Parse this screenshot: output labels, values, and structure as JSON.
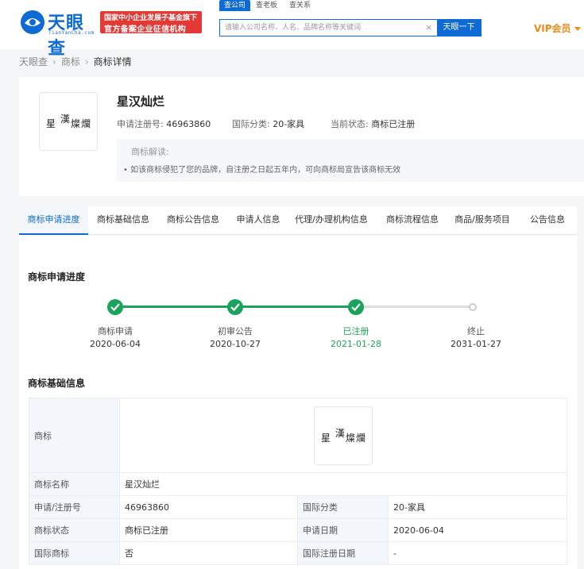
{
  "header": {
    "logo_name": "天眼查",
    "logo_sub": "TianYanCha.com",
    "badge_line1": "国家中小企业发展子基金旗下",
    "badge_line2": "官方备案企业征信机构",
    "search_tabs": [
      "查公司",
      "查老板",
      "查关系"
    ],
    "search_placeholder": "请输入公司名称、人名、品牌名称等关键词",
    "search_button": "天眼一下",
    "vip_label": "VIP会员"
  },
  "breadcrumb": [
    "天眼查",
    "商标",
    "商标详情"
  ],
  "summary": {
    "name": "星汉灿烂",
    "logo_text": [
      "星",
      "漢",
      "燦",
      "爛"
    ],
    "reg_no_label": "申请注册号:",
    "reg_no": "46963860",
    "intl_class_label": "国际分类:",
    "intl_class": "20-家具",
    "status_label": "当前状态:",
    "status": "商标已注册",
    "notice_title": "商标解读:",
    "notice_text": "如该商标侵犯了您的品牌，自注册之日起五年内，可向商标局宣告该商标无效"
  },
  "tabs": [
    "商标申请进度",
    "商标基础信息",
    "商标公告信息",
    "申请人信息",
    "代理/办理机构信息",
    "商标流程信息",
    "商品/服务项目",
    "公告信息"
  ],
  "progress": {
    "title": "商标申请进度",
    "steps": [
      {
        "label": "商标申请",
        "date": "2020-06-04",
        "done": true
      },
      {
        "label": "初审公告",
        "date": "2020-10-27",
        "done": true
      },
      {
        "label": "已注册",
        "date": "2021-01-28",
        "done": true,
        "current": true
      },
      {
        "label": "终止",
        "date": "2031-01-27",
        "done": false
      }
    ]
  },
  "basic_info": {
    "title": "商标基础信息",
    "logo_label": "商标",
    "name_label": "商标名称",
    "name_value": "星汉灿烂",
    "rows": [
      {
        "k1": "申请/注册号",
        "v1": "46963860",
        "k2": "国际分类",
        "v2": "20-家具"
      },
      {
        "k1": "商标状态",
        "v1": "商标已注册",
        "k2": "申请日期",
        "v2": "2020-06-04"
      },
      {
        "k1": "国际商标",
        "v1": "否",
        "k2": "国际注册日期",
        "v2": "-"
      }
    ]
  },
  "colors": {
    "brand": "#0f6bd4",
    "done": "#1aa35a",
    "vip": "#f08a16",
    "badge": "#e53935"
  }
}
